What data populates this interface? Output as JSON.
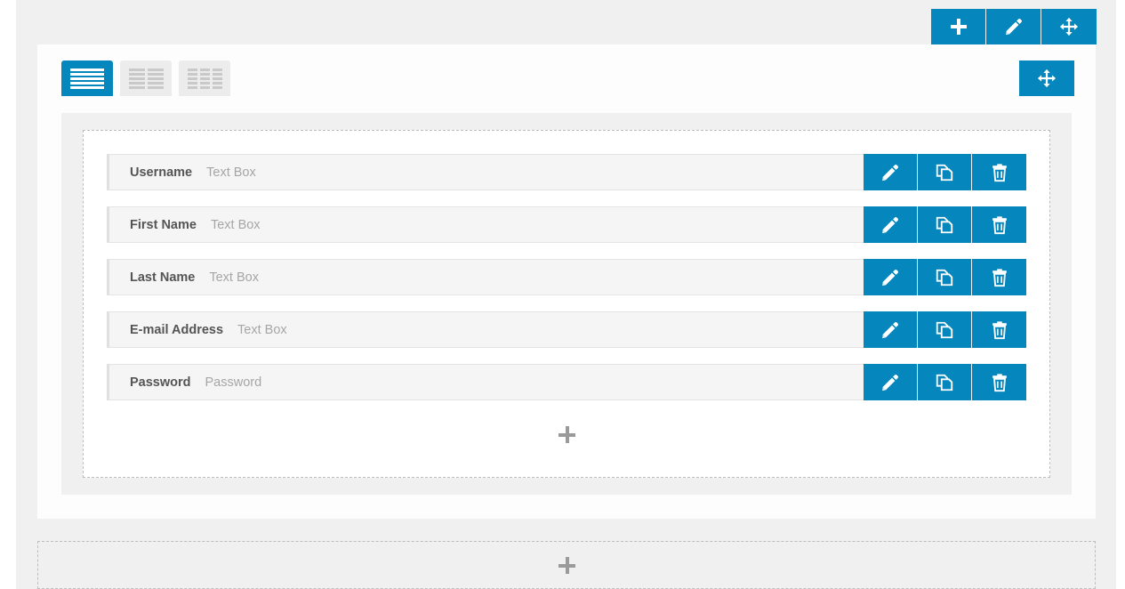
{
  "theme": {
    "accent": "#0587bd",
    "canvas_bg": "#f0f0f0",
    "card_bg": "#fdfdfd",
    "row_bg": "#f5f5f5",
    "label_color": "#555555",
    "placeholder_color": "#a6a6a6",
    "dashed_border": "#bdbdbd"
  },
  "page_toolbar": {
    "buttons": [
      {
        "name": "add-page-button",
        "icon": "plus-icon",
        "label": "Add"
      },
      {
        "name": "edit-page-button",
        "icon": "pencil-icon",
        "label": "Edit"
      },
      {
        "name": "move-page-button",
        "icon": "move-icon",
        "label": "Move"
      }
    ]
  },
  "layout_tabs": {
    "selected_index": 0,
    "items": [
      {
        "name": "layout-one-column",
        "icon": "one-column-icon",
        "label": "1 Column",
        "columns": 1,
        "active": true
      },
      {
        "name": "layout-two-column",
        "icon": "two-column-icon",
        "label": "2 Columns",
        "columns": 2,
        "active": false
      },
      {
        "name": "layout-three-column",
        "icon": "three-column-icon",
        "label": "3 Columns",
        "columns": 3,
        "active": false
      }
    ],
    "move_button": {
      "name": "move-section-button",
      "icon": "move-icon",
      "label": "Move Section"
    }
  },
  "row_actions": [
    {
      "name": "edit-field-button",
      "icon": "pencil-icon",
      "label": "Edit"
    },
    {
      "name": "duplicate-field-button",
      "icon": "copy-icon",
      "label": "Duplicate"
    },
    {
      "name": "delete-field-button",
      "icon": "trash-icon",
      "label": "Delete"
    }
  ],
  "fields": [
    {
      "label": "Username",
      "type": "Text Box"
    },
    {
      "label": "First Name",
      "type": "Text Box"
    },
    {
      "label": "Last Name",
      "type": "Text Box"
    },
    {
      "label": "E-mail Address",
      "type": "Text Box"
    },
    {
      "label": "Password",
      "type": "Password"
    }
  ],
  "add_field_button": {
    "name": "add-field-button",
    "icon": "plus-icon",
    "label": "Add Field"
  },
  "add_section_button": {
    "name": "add-section-button",
    "icon": "plus-icon",
    "label": "Add Section"
  }
}
